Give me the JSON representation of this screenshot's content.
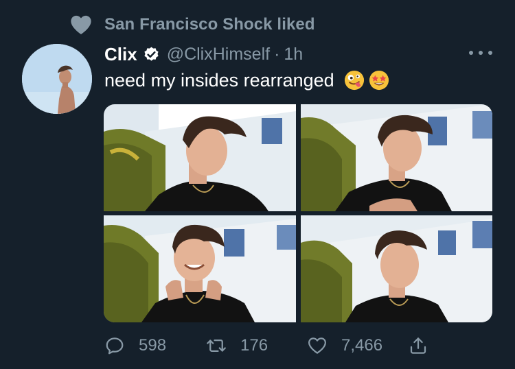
{
  "social_context": {
    "text": "San Francisco Shock liked",
    "icon": "heart-icon"
  },
  "tweet": {
    "display_name": "Clix",
    "verified_icon": "verified-badge-icon",
    "handle": "@ClixHimself",
    "separator": "·",
    "time": "1h",
    "text": "need my insides rearranged",
    "emojis": [
      "zany-face-emoji",
      "star-struck-emoji"
    ],
    "photos": [
      "photo-1",
      "photo-2",
      "photo-3",
      "photo-4"
    ]
  },
  "actions": {
    "reply_count": "598",
    "retweet_count": "176",
    "like_count": "7,466"
  },
  "colors": {
    "background": "#15202b",
    "secondary_text": "#8899a6",
    "primary_text": "#ffffff"
  }
}
